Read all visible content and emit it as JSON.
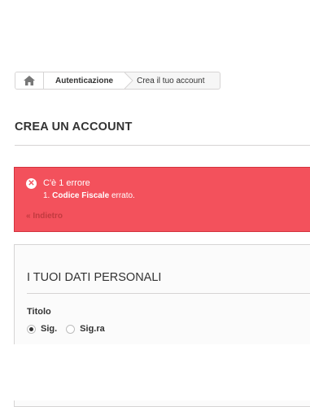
{
  "breadcrumb": {
    "home_icon": "home-icon",
    "items": [
      {
        "label": "Autenticazione"
      },
      {
        "label": "Crea il tuo account"
      }
    ]
  },
  "page": {
    "title": "CREA UN ACCOUNT"
  },
  "alert": {
    "icon": "close-circle-icon",
    "heading": "C'è 1 errore",
    "error_number": "1.",
    "error_field": "Codice Fiscale",
    "error_text": "errato.",
    "back_label": "« Indietro",
    "color": "#f3515c"
  },
  "personal": {
    "title": "I TUOI DATI PERSONALI",
    "field_label": "Titolo",
    "options": [
      {
        "label": "Sig.",
        "checked": true
      },
      {
        "label": "Sig.ra",
        "checked": false
      }
    ]
  }
}
